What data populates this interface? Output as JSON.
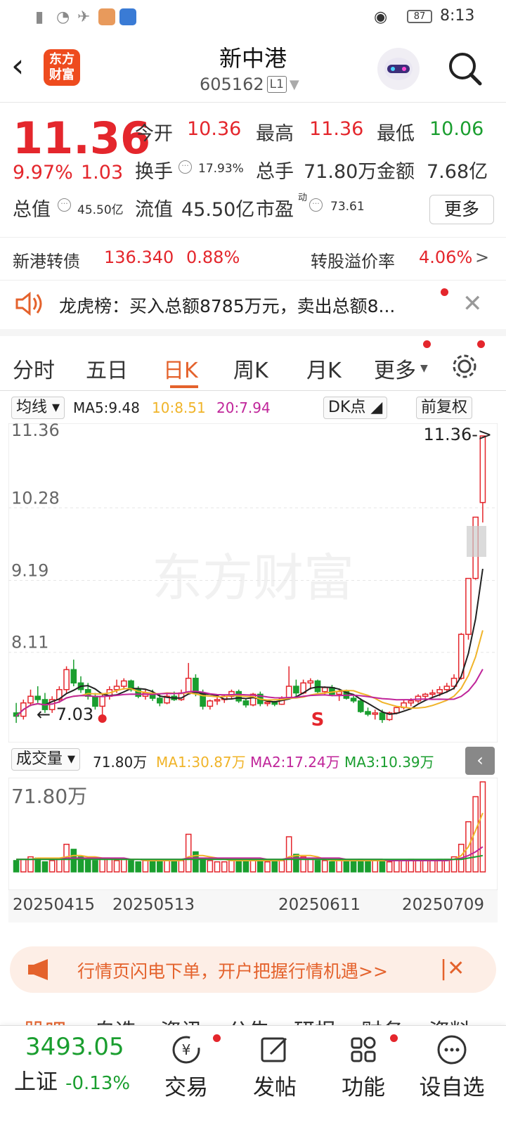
{
  "status_bar": {
    "time": "8:13",
    "battery": "87"
  },
  "header": {
    "stock_name": "新中港",
    "stock_code": "605162",
    "level_badge": "L1",
    "logo_text_1": "东方",
    "logo_text_2": "财富"
  },
  "quote": {
    "price": "11.36",
    "change_pct": "9.97%",
    "change_amt": "1.03",
    "open_label": "今开",
    "open": "10.36",
    "high_label": "最高",
    "high": "11.36",
    "low_label": "最低",
    "low": "10.06",
    "turnover_label": "换手",
    "turnover": "17.93%",
    "volume_label": "总手",
    "volume": "71.80万",
    "amount_label": "金额",
    "amount": "7.68亿",
    "total_value_label": "总值",
    "total_value": "45.50亿",
    "float_value_label": "流值",
    "float_value": "45.50亿",
    "pe_label": "市盈",
    "pe_sup": "动",
    "pe": "73.61",
    "more_label": "更多"
  },
  "bond": {
    "name": "新港转债",
    "price": "136.340",
    "pct": "0.88%",
    "premium_label": "转股溢价率",
    "premium": "4.06%"
  },
  "notice": {
    "text": "龙虎榜：买入总额8785万元，卖出总额8..."
  },
  "tabs": [
    "分时",
    "五日",
    "日K",
    "周K",
    "月K",
    "更多"
  ],
  "ma_row": {
    "selector": "均线",
    "ma5": "MA5:9.48",
    "ma10": "10:8.51",
    "ma20": "20:7.94",
    "dk_label": "DK点",
    "adjust_label": "前复权"
  },
  "chart_labels": {
    "y_ticks": [
      "11.36",
      "10.28",
      "9.19",
      "8.11",
      "7.03"
    ],
    "high_marker": "11.36->",
    "low_marker": "7.03",
    "signal": "S",
    "watermark": "东方财富"
  },
  "volume_row": {
    "selector": "成交量",
    "vol": "71.80万",
    "ma1": "MA1:30.87万",
    "ma2": "MA2:17.24万",
    "ma3": "MA3:10.39万",
    "max_label": "71.80万"
  },
  "colors": {
    "up": "#e4262c",
    "down": "#1a9e2f",
    "ma5": "#222222",
    "ma10": "#f0b429",
    "ma20": "#c0259a",
    "accent": "#e4622c"
  },
  "chart_data": {
    "type": "candlestick",
    "ylim": [
      7.03,
      11.36
    ],
    "x_ticks": [
      "20250415",
      "20250513",
      "20250611",
      "20250709"
    ],
    "ohlc": [
      [
        7.2,
        7.35,
        7.05,
        7.15
      ],
      [
        7.15,
        7.4,
        7.1,
        7.35
      ],
      [
        7.35,
        7.55,
        7.3,
        7.45
      ],
      [
        7.45,
        7.6,
        7.35,
        7.4
      ],
      [
        7.4,
        7.5,
        7.2,
        7.25
      ],
      [
        7.25,
        7.45,
        7.2,
        7.4
      ],
      [
        7.4,
        7.6,
        7.35,
        7.55
      ],
      [
        7.55,
        7.9,
        7.5,
        7.85
      ],
      [
        7.85,
        8.0,
        7.6,
        7.65
      ],
      [
        7.65,
        7.75,
        7.5,
        7.55
      ],
      [
        7.55,
        7.65,
        7.4,
        7.45
      ],
      [
        7.45,
        7.5,
        7.25,
        7.3
      ],
      [
        7.3,
        7.5,
        7.1,
        7.45
      ],
      [
        7.45,
        7.6,
        7.4,
        7.55
      ],
      [
        7.55,
        7.7,
        7.5,
        7.6
      ],
      [
        7.6,
        7.72,
        7.55,
        7.68
      ],
      [
        7.68,
        7.7,
        7.52,
        7.55
      ],
      [
        7.55,
        7.6,
        7.42,
        7.45
      ],
      [
        7.45,
        7.55,
        7.4,
        7.5
      ],
      [
        7.5,
        7.55,
        7.38,
        7.42
      ],
      [
        7.42,
        7.48,
        7.3,
        7.35
      ],
      [
        7.35,
        7.5,
        7.33,
        7.45
      ],
      [
        7.45,
        7.52,
        7.38,
        7.4
      ],
      [
        7.4,
        7.55,
        7.38,
        7.5
      ],
      [
        7.5,
        7.95,
        7.48,
        7.72
      ],
      [
        7.72,
        7.78,
        7.45,
        7.5
      ],
      [
        7.5,
        7.55,
        7.25,
        7.3
      ],
      [
        7.3,
        7.4,
        7.25,
        7.38
      ],
      [
        7.38,
        7.45,
        7.32,
        7.4
      ],
      [
        7.4,
        7.48,
        7.35,
        7.45
      ],
      [
        7.45,
        7.55,
        7.4,
        7.52
      ],
      [
        7.52,
        7.55,
        7.35,
        7.38
      ],
      [
        7.38,
        7.42,
        7.28,
        7.32
      ],
      [
        7.32,
        7.5,
        7.3,
        7.48
      ],
      [
        7.48,
        7.52,
        7.3,
        7.34
      ],
      [
        7.34,
        7.4,
        7.3,
        7.36
      ],
      [
        7.36,
        7.38,
        7.3,
        7.33
      ],
      [
        7.33,
        7.45,
        7.32,
        7.42
      ],
      [
        7.42,
        7.9,
        7.4,
        7.6
      ],
      [
        7.6,
        7.7,
        7.45,
        7.5
      ],
      [
        7.5,
        7.7,
        7.48,
        7.65
      ],
      [
        7.65,
        7.72,
        7.55,
        7.68
      ],
      [
        7.68,
        7.7,
        7.5,
        7.52
      ],
      [
        7.52,
        7.6,
        7.48,
        7.58
      ],
      [
        7.58,
        7.62,
        7.45,
        7.48
      ],
      [
        7.48,
        7.55,
        7.38,
        7.52
      ],
      [
        7.52,
        7.55,
        7.4,
        7.42
      ],
      [
        7.42,
        7.48,
        7.35,
        7.38
      ],
      [
        7.38,
        7.42,
        7.2,
        7.22
      ],
      [
        7.22,
        7.28,
        7.15,
        7.18
      ],
      [
        7.18,
        7.25,
        7.1,
        7.2
      ],
      [
        7.2,
        7.25,
        7.05,
        7.1
      ],
      [
        7.1,
        7.22,
        7.08,
        7.2
      ],
      [
        7.2,
        7.3,
        7.18,
        7.28
      ],
      [
        7.28,
        7.4,
        7.25,
        7.35
      ],
      [
        7.35,
        7.42,
        7.3,
        7.38
      ],
      [
        7.38,
        7.48,
        7.35,
        7.45
      ],
      [
        7.45,
        7.5,
        7.4,
        7.48
      ],
      [
        7.48,
        7.55,
        7.42,
        7.5
      ],
      [
        7.5,
        7.6,
        7.45,
        7.55
      ],
      [
        7.55,
        7.65,
        7.5,
        7.6
      ],
      [
        7.6,
        7.78,
        7.55,
        7.72
      ],
      [
        7.72,
        8.4,
        7.7,
        8.38
      ],
      [
        8.38,
        9.22,
        8.3,
        9.22
      ],
      [
        9.22,
        10.14,
        9.2,
        10.14
      ],
      [
        10.36,
        11.36,
        10.06,
        11.36
      ]
    ],
    "volume": [
      9,
      10,
      12,
      11,
      8,
      9,
      10,
      22,
      18,
      12,
      10,
      9,
      11,
      10,
      9,
      10,
      9,
      8,
      9,
      8,
      8,
      9,
      8,
      9,
      30,
      16,
      11,
      9,
      8,
      8,
      9,
      9,
      8,
      10,
      9,
      8,
      8,
      9,
      28,
      14,
      12,
      10,
      9,
      9,
      8,
      9,
      9,
      8,
      10,
      9,
      9,
      8,
      8,
      9,
      9,
      10,
      9,
      9,
      9,
      10,
      10,
      12,
      22,
      40,
      60,
      71.8
    ],
    "vol_ma1": [
      10,
      10,
      10,
      11,
      11,
      11,
      11,
      12,
      13,
      13,
      12,
      12,
      11,
      11,
      10,
      10,
      10,
      10,
      9,
      9,
      9,
      9,
      9,
      9,
      12,
      13,
      13,
      12,
      11,
      10,
      9,
      9,
      9,
      9,
      9,
      9,
      9,
      9,
      12,
      13,
      13,
      13,
      12,
      10,
      9,
      9,
      9,
      9,
      9,
      9,
      9,
      9,
      9,
      9,
      9,
      9,
      9,
      9,
      9,
      9,
      9,
      10,
      13,
      20,
      33,
      47
    ],
    "vol_ma2": [
      10,
      10,
      10,
      10,
      10,
      10,
      10,
      11,
      11,
      11,
      11,
      11,
      11,
      11,
      11,
      11,
      10,
      10,
      10,
      10,
      10,
      10,
      10,
      10,
      11,
      11,
      11,
      11,
      11,
      11,
      11,
      11,
      11,
      11,
      11,
      10,
      10,
      10,
      11,
      11,
      11,
      11,
      11,
      11,
      11,
      11,
      10,
      10,
      10,
      10,
      10,
      10,
      9,
      9,
      9,
      9,
      9,
      9,
      9,
      9,
      9,
      10,
      11,
      13,
      16,
      20
    ],
    "vol_ma3": [
      10,
      10,
      10,
      10,
      10,
      10,
      10,
      10,
      10,
      10,
      10,
      10,
      10,
      10,
      10,
      10,
      10,
      10,
      10,
      10,
      10,
      10,
      10,
      10,
      10,
      10,
      10,
      10,
      10,
      10,
      10,
      10,
      10,
      10,
      10,
      10,
      10,
      10,
      10,
      10,
      10,
      10,
      10,
      10,
      10,
      10,
      10,
      10,
      10,
      10,
      10,
      10,
      10,
      10,
      10,
      10,
      10,
      10,
      10,
      10,
      10,
      10,
      10,
      11,
      12,
      13
    ]
  },
  "banner": {
    "text": "行情页闪电下单，开户把握行情机遇>>"
  },
  "cut_tabs": [
    "股吧",
    "自选",
    "资讯",
    "公告",
    "研报",
    "财务",
    "资料"
  ],
  "bottom_nav": {
    "index_value": "3493.05",
    "index_name": "上证",
    "index_pct": "-0.13%",
    "trade": "交易",
    "post": "发帖",
    "function": "功能",
    "watchlist": "设自选"
  }
}
